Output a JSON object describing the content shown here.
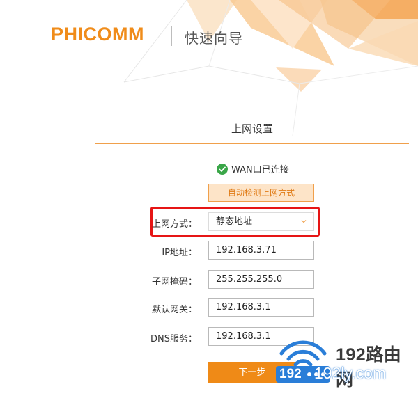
{
  "header": {
    "brand": "PHICOMM",
    "title": "快速向导"
  },
  "section": {
    "title": "上网设置"
  },
  "wan_status": {
    "text": "WAN口已连接",
    "icon": "check-circle-icon",
    "color": "#3aa648"
  },
  "detect_button": {
    "label": "自动检测上网方式"
  },
  "connection_type": {
    "label": "上网方式：",
    "value": "静态地址"
  },
  "fields": {
    "ip": {
      "label": "IP地址：",
      "value": "192.168.3.71"
    },
    "mask": {
      "label": "子网掩码：",
      "value": "255.255.255.0"
    },
    "gateway": {
      "label": "默认网关：",
      "value": "192.168.3.1"
    },
    "dns": {
      "label": "DNS服务：",
      "value": "192.168.3.1"
    }
  },
  "next_button": {
    "label": "下一步"
  },
  "watermark": {
    "brand": "192路由网",
    "url": "192ly.com",
    "prefix": "192"
  },
  "colors": {
    "accent": "#ef8a17",
    "highlight": "#e61515",
    "link_blue": "#2a7ed8"
  }
}
